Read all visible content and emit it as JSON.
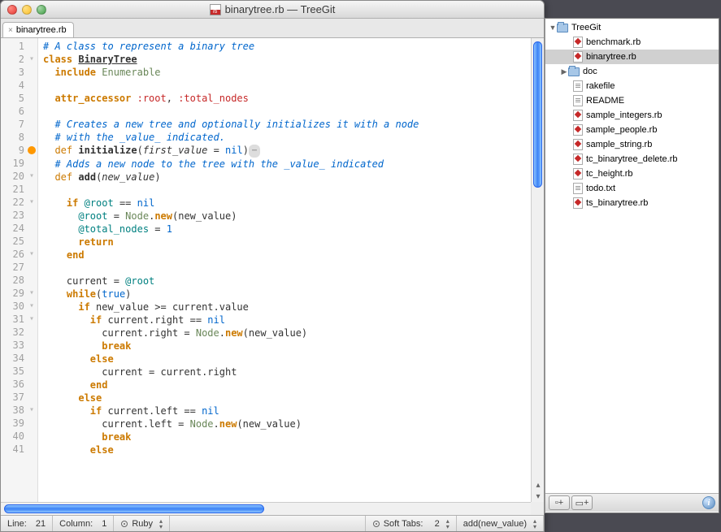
{
  "window": {
    "title_file": "binarytree.rb",
    "title_project": "TreeGit",
    "title_sep": " — "
  },
  "tab": {
    "label": "binarytree.rb"
  },
  "gutter": {
    "lines": [
      1,
      2,
      3,
      4,
      5,
      6,
      7,
      8,
      9,
      19,
      20,
      21,
      22,
      23,
      24,
      25,
      26,
      27,
      28,
      29,
      30,
      31,
      32,
      33,
      34,
      35,
      36,
      37,
      38,
      39,
      40,
      41
    ],
    "folds": [
      2,
      9,
      20,
      22,
      26,
      29,
      30,
      31,
      38
    ],
    "breakpoint": 9
  },
  "code": {
    "l1": "# A class to represent a binary tree",
    "l2_kw": "class",
    "l2_name": "BinaryTree",
    "l3_kw": "include",
    "l3_mod": "Enumerable",
    "l5_kw": "attr_accessor",
    "l5_s1": ":root",
    "l5_s2": ":total_nodes",
    "l7": "# Creates a new tree and optionally initializes it with a node",
    "l8": "# with the _value_ indicated.",
    "l9_kw": "def",
    "l9_name": "initialize",
    "l9_p": "first_value",
    "l9_eq": " = ",
    "l9_nil": "nil",
    "l19": "# Adds a new node to the tree with the _value_ indicated",
    "l20_kw": "def",
    "l20_name": "add",
    "l20_p": "new_value",
    "l22_if": "if",
    "l22_v": "@root",
    "l22_op": " == ",
    "l22_nil": "nil",
    "l23_v": "@root",
    "l23_eq": " = ",
    "l23_c": "Node",
    "l23_dot": ".",
    "l23_m": "new",
    "l23_arg": "new_value",
    "l24_v": "@total_nodes",
    "l24_eq": " = ",
    "l24_n": "1",
    "l25": "return",
    "l26": "end",
    "l28_lhs": "current",
    "l28_eq": " = ",
    "l28_v": "@root",
    "l29_kw": "while",
    "l29_t": "true",
    "l30_if": "if",
    "l30_l": "new_value",
    "l30_op": " >= ",
    "l30_r": "current.value",
    "l31_if": "if",
    "l31_l": "current.right",
    "l31_op": " == ",
    "l31_nil": "nil",
    "l32_lhs": "current.right",
    "l32_eq": " = ",
    "l32_c": "Node",
    "l32_m": "new",
    "l32_arg": "new_value",
    "l33": "break",
    "l34": "else",
    "l35_lhs": "current",
    "l35_eq": " = ",
    "l35_r": "current.right",
    "l36": "end",
    "l37": "else",
    "l38_if": "if",
    "l38_l": "current.left",
    "l38_op": " == ",
    "l38_nil": "nil",
    "l39_lhs": "current.left",
    "l39_eq": " = ",
    "l39_c": "Node",
    "l39_m": "new",
    "l39_arg": "new_value",
    "l40": "break",
    "l41": "else"
  },
  "status": {
    "line_label": "Line:",
    "line_val": "21",
    "col_label": "Column:",
    "col_val": "1",
    "language": "Ruby",
    "softtabs_label": "Soft Tabs:",
    "softtabs_val": "2",
    "scope": "add(new_value)"
  },
  "drawer": {
    "root": "TreeGit",
    "items": [
      {
        "name": "benchmark.rb",
        "type": "ruby"
      },
      {
        "name": "binarytree.rb",
        "type": "ruby",
        "selected": true
      },
      {
        "name": "doc",
        "type": "folder"
      },
      {
        "name": "rakefile",
        "type": "txt"
      },
      {
        "name": "README",
        "type": "txt"
      },
      {
        "name": "sample_integers.rb",
        "type": "ruby"
      },
      {
        "name": "sample_people.rb",
        "type": "ruby"
      },
      {
        "name": "sample_string.rb",
        "type": "ruby"
      },
      {
        "name": "tc_binarytree_delete.rb",
        "type": "ruby"
      },
      {
        "name": "tc_height.rb",
        "type": "ruby"
      },
      {
        "name": "todo.txt",
        "type": "txt"
      },
      {
        "name": "ts_binarytree.rb",
        "type": "ruby"
      }
    ],
    "btn_newfile": "+",
    "btn_newfolder": "+",
    "btn_info": "i"
  }
}
